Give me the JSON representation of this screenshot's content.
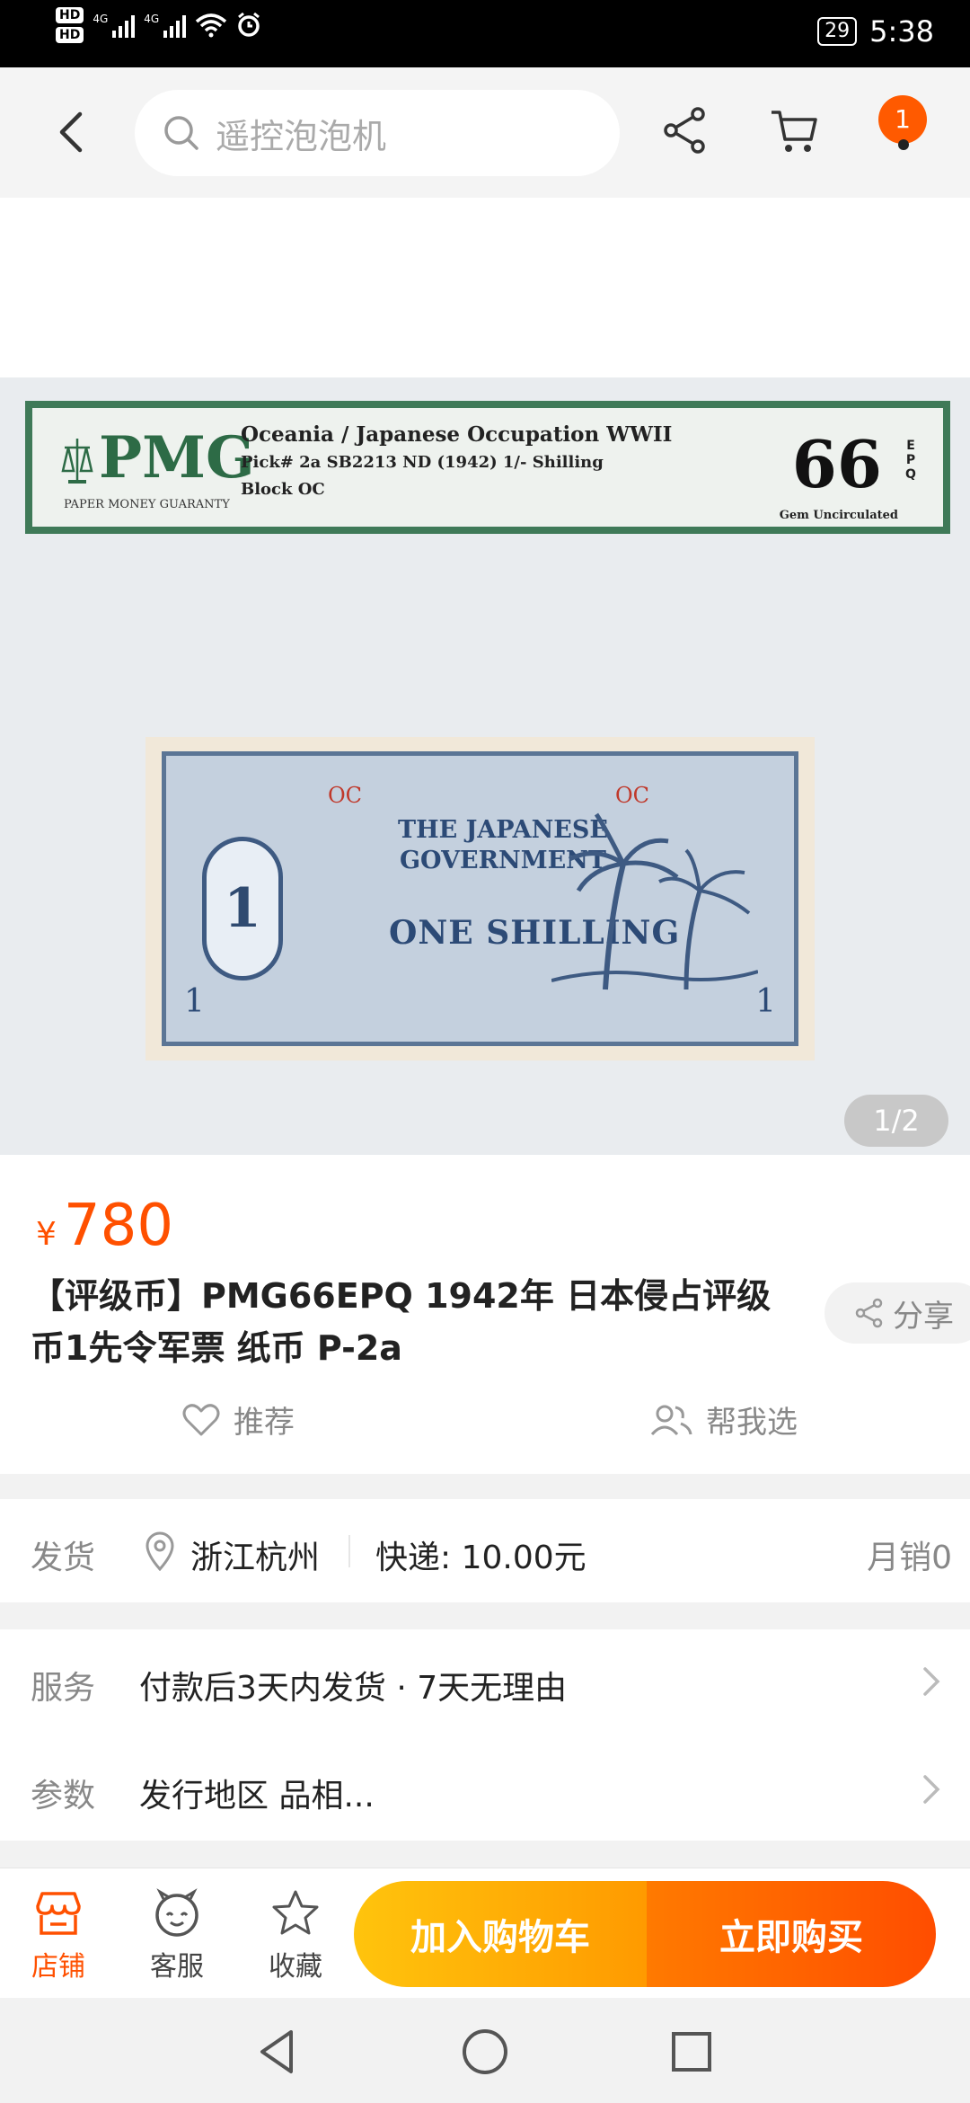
{
  "status_bar": {
    "hd1": "HD",
    "hd2": "HD",
    "net1": "4G",
    "net2": "4G",
    "battery": "29",
    "time": "5:38"
  },
  "header": {
    "search_placeholder": "遥控泡泡机",
    "cart_badge": "1"
  },
  "gallery": {
    "label": {
      "brand": "PMG",
      "brand_sub": "PAPER MONEY GUARANTY",
      "line1": "Oceania / Japanese Occupation WWII",
      "line2": "Pick# 2a   SB2213     ND (1942)   1/- Shilling",
      "line3": "Block OC",
      "grade": "66",
      "grade_suffix": "EPQ",
      "grade_desc": "Gem Uncirculated"
    },
    "note": {
      "oc_left": "OC",
      "oc_right": "OC",
      "title_line1": "THE JAPANESE",
      "title_line2": "GOVERNMENT",
      "value": "ONE SHILLING",
      "oval_digit": "1",
      "corner_left": "1",
      "corner_right": "1"
    },
    "pager": "1/2"
  },
  "product": {
    "currency": "¥",
    "price": "780",
    "title": "【评级币】PMG66EPQ 1942年 日本侵占评级币1先令军票 纸币 P-2a",
    "share_label": "分享",
    "recommend_label": "推荐",
    "help_choose_label": "帮我选"
  },
  "delivery": {
    "label": "发货",
    "location": "浙江杭州",
    "shipping": "快递: 10.00元",
    "monthly_sales": "月销0"
  },
  "services": {
    "service_label": "服务",
    "service_text": "付款后3天内发货 · 7天无理由",
    "params_label": "参数",
    "params_text": "发行地区 品相..."
  },
  "bottom_bar": {
    "shop": "店铺",
    "service": "客服",
    "favorite": "收藏",
    "add_to_cart": "加入购物车",
    "buy_now": "立即购买"
  },
  "colors": {
    "accent": "#ff5000",
    "cart_button": "#ffb000",
    "buy_button": "#ff5a00",
    "pmg_green": "#3f7a58"
  }
}
